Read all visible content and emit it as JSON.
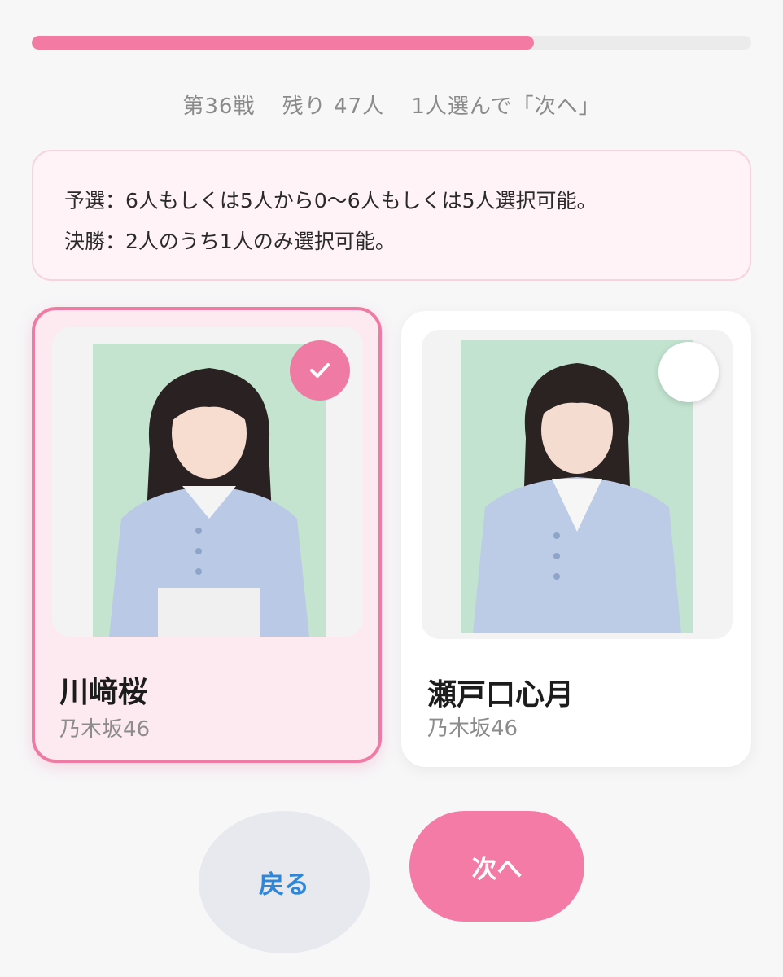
{
  "progress": {
    "fraction": 0.698,
    "fill_color": "#f27aa3"
  },
  "round_info": {
    "round": "第36戦",
    "remaining": "残り 47人",
    "instruction": "1人選んで「次へ」"
  },
  "notice": {
    "line1": "予選：6人もしくは5人から0〜6人もしくは5人選択可能。",
    "line2": "決勝：2人のうち1人のみ選択可能。"
  },
  "candidates": [
    {
      "name": "川﨑桜",
      "group": "乃木坂46",
      "selected": true,
      "icon": "checkmark-icon"
    },
    {
      "name": "瀬戸口心月",
      "group": "乃木坂46",
      "selected": false,
      "icon": "empty-circle-icon"
    }
  ],
  "buttons": {
    "back_label": "戻る",
    "next_label": "次へ"
  },
  "colors": {
    "accent": "#ef7ba4",
    "back_text": "#2e86d9"
  }
}
